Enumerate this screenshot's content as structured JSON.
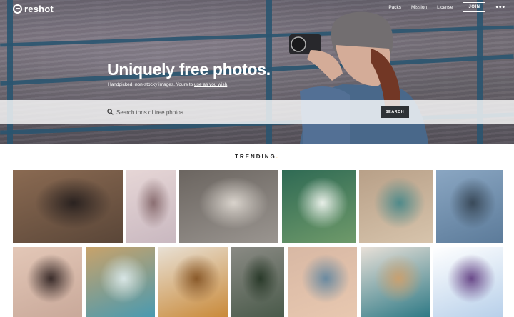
{
  "brand": {
    "name": "reshot"
  },
  "nav": {
    "packs": "Packs",
    "mission": "Mission",
    "license": "License",
    "join": "JOIN",
    "more": "•••"
  },
  "hero": {
    "headline": "Uniquely free photos.",
    "sub_prefix": "Handpicked, non-stocky images. Yours to ",
    "sub_link": "use as you wish",
    "sub_suffix": "."
  },
  "search": {
    "placeholder": "Search tons of free photos...",
    "button": "SEARCH"
  },
  "trending": {
    "label": "TRENDING",
    "dot": "."
  },
  "photos": [
    {
      "name": "woman-record-player",
      "colors": [
        "#5a4638",
        "#8a6a52",
        "#2a2220"
      ]
    },
    {
      "name": "girl-flower-crown",
      "colors": [
        "#c9b8c0",
        "#e6d6d6",
        "#8b6f72"
      ]
    },
    {
      "name": "pillow-fight",
      "colors": [
        "#9a9590",
        "#6b6560",
        "#d9d3cc"
      ]
    },
    {
      "name": "ocean-wave-surfer",
      "colors": [
        "#6f9a6a",
        "#2f6a54",
        "#e8efe8"
      ]
    },
    {
      "name": "hands-candy-cane",
      "colors": [
        "#d7c4ac",
        "#b8a088",
        "#4f8a8a"
      ]
    },
    {
      "name": "new-york-skyline",
      "colors": [
        "#5c7b9a",
        "#8aa6c2",
        "#3a4a5a"
      ]
    },
    {
      "name": "man-dancing",
      "colors": [
        "#c9a99a",
        "#e3c7b7",
        "#3a2c2a"
      ]
    },
    {
      "name": "beach-cove",
      "colors": [
        "#4a9ab0",
        "#c8a26a",
        "#d8e6e6"
      ]
    },
    {
      "name": "breakfast-toast",
      "colors": [
        "#c98a3a",
        "#e8e0d4",
        "#8a5a2a"
      ]
    },
    {
      "name": "woman-forest-road",
      "colors": [
        "#4a5a4a",
        "#8a8a84",
        "#2a3a2a"
      ]
    },
    {
      "name": "hands-together",
      "colors": [
        "#e8c8b0",
        "#d8b8a4",
        "#6a8aa0"
      ]
    },
    {
      "name": "teal-bedroom",
      "colors": [
        "#2f7a86",
        "#e8e0d8",
        "#c8a070"
      ]
    },
    {
      "name": "snow-kid",
      "colors": [
        "#b8d0ea",
        "#ffffff",
        "#6a4a8a"
      ]
    }
  ]
}
